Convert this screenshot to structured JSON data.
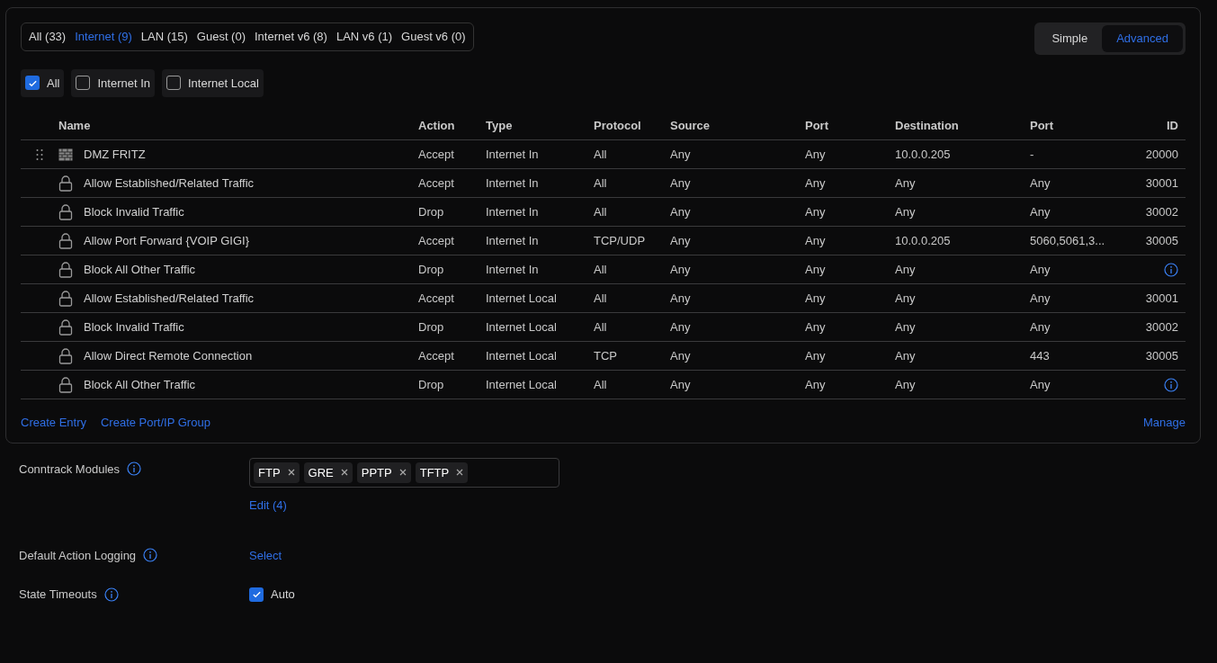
{
  "zone_tabs": [
    {
      "label": "All (33)",
      "selected": false
    },
    {
      "label": "Internet (9)",
      "selected": true
    },
    {
      "label": "LAN (15)",
      "selected": false
    },
    {
      "label": "Guest (0)",
      "selected": false
    },
    {
      "label": "Internet v6 (8)",
      "selected": false
    },
    {
      "label": "LAN v6 (1)",
      "selected": false
    },
    {
      "label": "Guest v6 (0)",
      "selected": false
    }
  ],
  "view_toggle": [
    {
      "label": "Simple",
      "selected": false
    },
    {
      "label": "Advanced",
      "selected": true
    }
  ],
  "type_filters": [
    {
      "label": "All",
      "checked": true
    },
    {
      "label": "Internet In",
      "checked": false
    },
    {
      "label": "Internet Local",
      "checked": false
    }
  ],
  "table": {
    "columns": [
      "Name",
      "Action",
      "Type",
      "Protocol",
      "Source",
      "Port",
      "Destination",
      "Port",
      "ID"
    ],
    "rows": [
      {
        "kind": "custom",
        "cells": [
          "DMZ FRITZ",
          "Accept",
          "Internet In",
          "All",
          "Any",
          "Any",
          "10.0.0.205",
          "-"
        ],
        "id": "20000"
      },
      {
        "kind": "predefined",
        "cells": [
          "Allow Established/Related Traffic",
          "Accept",
          "Internet In",
          "All",
          "Any",
          "Any",
          "Any",
          "Any"
        ],
        "id": "30001"
      },
      {
        "kind": "predefined",
        "cells": [
          "Block Invalid Traffic",
          "Drop",
          "Internet In",
          "All",
          "Any",
          "Any",
          "Any",
          "Any"
        ],
        "id": "30002"
      },
      {
        "kind": "predefined",
        "cells": [
          "Allow Port Forward {VOIP GIGI}",
          "Accept",
          "Internet In",
          "TCP/UDP",
          "Any",
          "Any",
          "10.0.0.205",
          "5060,5061,3..."
        ],
        "id": "30005"
      },
      {
        "kind": "predefined",
        "cells": [
          "Block All Other Traffic",
          "Drop",
          "Internet In",
          "All",
          "Any",
          "Any",
          "Any",
          "Any"
        ]
      },
      {
        "kind": "predefined",
        "cells": [
          "Allow Established/Related Traffic",
          "Accept",
          "Internet Local",
          "All",
          "Any",
          "Any",
          "Any",
          "Any"
        ],
        "id": "30001"
      },
      {
        "kind": "predefined",
        "cells": [
          "Block Invalid Traffic",
          "Drop",
          "Internet Local",
          "All",
          "Any",
          "Any",
          "Any",
          "Any"
        ],
        "id": "30002"
      },
      {
        "kind": "predefined",
        "cells": [
          "Allow Direct Remote Connection",
          "Accept",
          "Internet Local",
          "TCP",
          "Any",
          "Any",
          "Any",
          "443"
        ],
        "id": "30005"
      },
      {
        "kind": "predefined",
        "cells": [
          "Block All Other Traffic",
          "Drop",
          "Internet Local",
          "All",
          "Any",
          "Any",
          "Any",
          "Any"
        ]
      }
    ]
  },
  "footer_links": [
    "Create Entry",
    "Create Port/IP Group"
  ],
  "manage_link": "Manage",
  "settings": {
    "conntrack": {
      "label": "Conntrack Modules",
      "tags": [
        "FTP",
        "GRE",
        "PPTP",
        "TFTP"
      ],
      "edit_link": "Edit (4)"
    },
    "logging": {
      "label": "Default Action Logging",
      "select_link": "Select"
    },
    "timeouts": {
      "label": "State Timeouts",
      "auto_label": "Auto",
      "auto_checked": true
    }
  }
}
